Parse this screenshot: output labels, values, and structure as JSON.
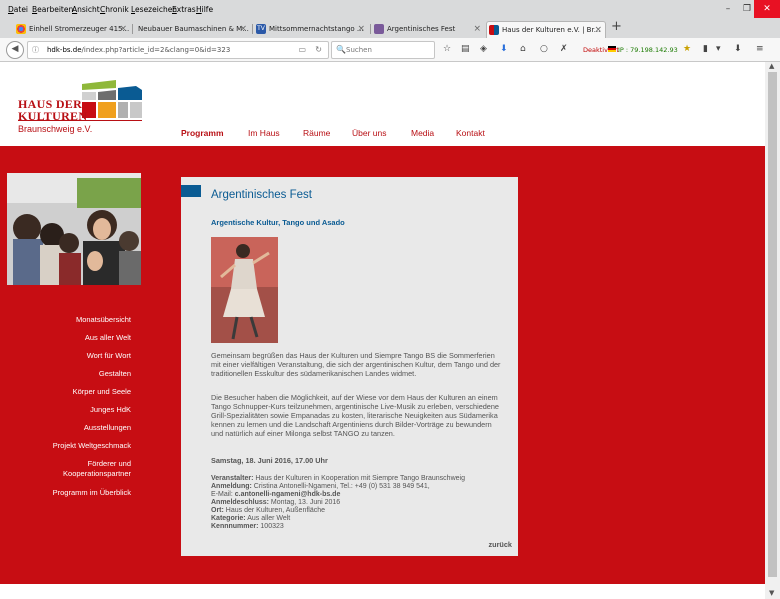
{
  "menubar": {
    "items": [
      "Datei",
      "Bearbeiten",
      "Ansicht",
      "Chronik",
      "Lesezeichen",
      "Extras",
      "Hilfe"
    ],
    "minimize": "–",
    "maximize": "❐",
    "close": "✕"
  },
  "tabs": [
    {
      "label": "Einhell Stromerzeuger 415...",
      "icon": "google-chrome-icon"
    },
    {
      "label": "Neubauer Baumaschinen & M...",
      "icon": "none"
    },
    {
      "label": "Mittsommernachtstango ...",
      "icon": "tv-icon"
    },
    {
      "label": "Argentinisches Fest",
      "icon": "puzzle-icon"
    },
    {
      "label": "Haus der Kulturen e.V. | Br...",
      "icon": "hdk-icon",
      "active": true
    }
  ],
  "newtab": "+",
  "navbar": {
    "url_host": "hdk-bs.de",
    "url_path": "/index.php?article_id=2&clang=0&id=323",
    "search_placeholder": "Suchen",
    "vpn_status": "Deaktiviert",
    "ip": "IP : 79.198.142.93"
  },
  "site": {
    "logo_line1": "HAUS DER",
    "logo_line2": "KULTUREN",
    "logo_sub": "Braunschweig e.V.",
    "brand_color": "#c70d13",
    "accent_color": "#0a5b93",
    "nav": [
      {
        "label": "Programm",
        "active": true
      },
      {
        "label": "Im Haus"
      },
      {
        "label": "Räume"
      },
      {
        "label": "Über uns"
      },
      {
        "label": "Media"
      },
      {
        "label": "Kontakt"
      }
    ],
    "sidenav": [
      "Monatsübersicht",
      "Aus aller Welt",
      "Wort für Wort",
      "Gestalten",
      "Körper und Seele",
      "Junges HdK",
      "Ausstellungen",
      "Projekt Weltgeschmack",
      "Förderer und Kooperationspartner",
      "Programm im Überblick"
    ]
  },
  "article": {
    "title": "Argentinisches Fest",
    "subtitle": "Argentische Kultur, Tango und Asado",
    "para1": "Gemeinsam begrüßen das Haus der Kulturen und Siempre Tango BS die Sommerferien mit einer vielfältigen Veranstaltung, die sich der argentinischen Kultur, dem Tango und der traditionellen Esskultur des südamerikanischen Landes widmet.",
    "para2": "Die Besucher haben die Möglichkeit, auf der Wiese vor dem Haus der Kulturen an einem Tango Schnupper-Kurs teilzunehmen, argentinische Live-Musik zu erleben, verschiedene Grill-Spezialitäten sowie Empanadas zu kosten, literarische Neuigkeiten aus Südamerika kennen zu lernen und die Landschaft Argentiniens durch Bilder-Vorträge zu bewundern und natürlich auf einer Milonga selbst TANGO zu tanzen.",
    "date": "Samstag, 18. Juni 2016, 17.00 Uhr",
    "meta": {
      "veranstalter_label": "Veranstalter:",
      "veranstalter": "Haus der Kulturen in Kooperation mit Siempre Tango Braunschweig",
      "anmeldung_label": "Anmeldung:",
      "anmeldung": "Cristina Antonelli-Ngameni, Tel.: +49 (0) 531 38 949 541,",
      "email_label": "E-Mail:",
      "email": "c.antonelli-ngameni@hdk-bs.de",
      "schluss_label": "Anmeldeschluss:",
      "schluss": "Montag, 13. Juni 2016",
      "ort_label": "Ort:",
      "ort": "Haus der Kulturen, Außenfläche",
      "kategorie_label": "Kategorie:",
      "kategorie": "Aus aller Welt",
      "kennnummer_label": "Kennnummer:",
      "kennnummer": "100323"
    },
    "back": "zurück"
  }
}
